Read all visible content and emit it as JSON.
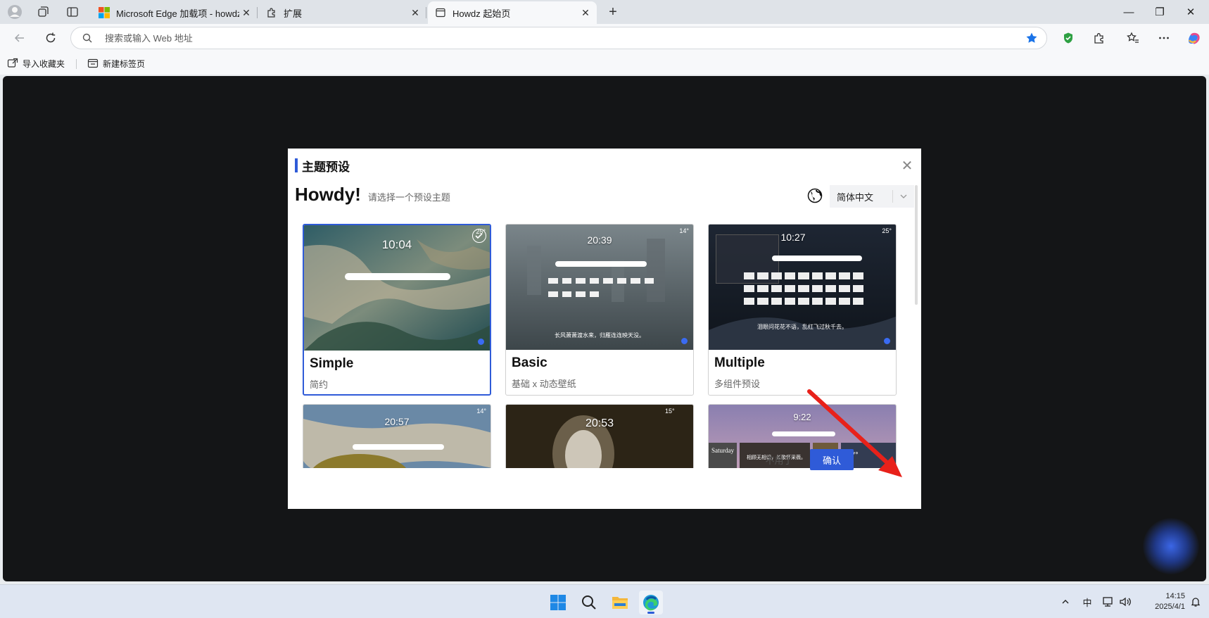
{
  "browser": {
    "tabs": [
      {
        "title": "Microsoft Edge 加载项 - howdz起",
        "favicon": "microsoft-logo-icon",
        "active": false
      },
      {
        "title": "扩展",
        "favicon": "puzzle-icon",
        "active": false
      },
      {
        "title": "Howdz 起始页",
        "favicon": "page-icon",
        "active": true
      }
    ],
    "new_tab_symbol": "+",
    "window_controls": {
      "minimize": "—",
      "restore": "❐",
      "close": "✕"
    },
    "address": {
      "value": "",
      "placeholder": "搜索或输入 Web 地址"
    },
    "favorites_bar": [
      {
        "label": "导入收藏夹",
        "icon": "import-favorites-icon"
      },
      {
        "label": "新建标签页",
        "icon": "new-tab-page-icon"
      }
    ]
  },
  "modal": {
    "title": "主题预设",
    "close_symbol": "✕",
    "greeting": "Howdy!",
    "subtitle": "请选择一个预设主题",
    "language": {
      "selected": "简体中文"
    },
    "cards": [
      {
        "title": "Simple",
        "desc": "简约",
        "selected": true,
        "preview": {
          "time": "10:04",
          "weather": "25°"
        }
      },
      {
        "title": "Basic",
        "desc": "基础 x 动态壁纸",
        "selected": false,
        "preview": {
          "time": "20:39",
          "weather": "14°",
          "quote": "长风萧萧渡水来，归雁连连映天没。"
        }
      },
      {
        "title": "Multiple",
        "desc": "多组件预设",
        "selected": false,
        "preview": {
          "time": "10:27",
          "weather": "25°",
          "quote": "泪眼问花花不语，乱红飞过秋千去。"
        }
      },
      {
        "title": "",
        "desc": "",
        "selected": false,
        "preview": {
          "time": "20:57",
          "weather": "14°"
        }
      },
      {
        "title": "",
        "desc": "",
        "selected": false,
        "preview": {
          "time": "20:53",
          "weather": "15°"
        }
      },
      {
        "title": "",
        "desc": "",
        "selected": false,
        "preview": {
          "time": "9:22",
          "weather": "17°",
          "day": "Saturday",
          "quote": "相顾无相识，长歌怀采薇。"
        }
      }
    ],
    "buttons": {
      "cancel": "不用了",
      "confirm": "确认"
    }
  },
  "taskbar": {
    "apps": [
      "windows-start-icon",
      "search-icon",
      "file-explorer-icon",
      "edge-icon"
    ],
    "tray": {
      "ime": "中"
    },
    "clock": {
      "time": "14:15",
      "date": "2025/4/1"
    }
  },
  "colors": {
    "accent": "#2f5bd8",
    "page_bg": "#141517",
    "annotation_arrow": "#e8211a"
  }
}
